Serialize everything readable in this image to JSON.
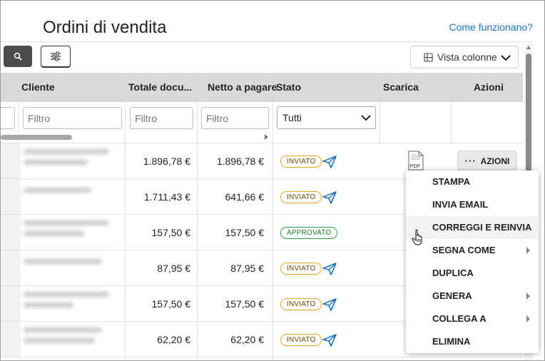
{
  "page": {
    "title": "Ordini di vendita",
    "help_link": "Come funzionano?"
  },
  "toolbar": {
    "search_icon": "search-icon",
    "filter_icon": "sliders-icon",
    "columns_button": "Vista colonne"
  },
  "table": {
    "columns": [
      "Cliente",
      "Totale docu...",
      "Netto a pagare",
      "Stato",
      "Scarica",
      "Azioni"
    ],
    "filter_placeholder": "Filtro",
    "status_filter": "Tutti",
    "rows": [
      {
        "totale": "1.896,78 €",
        "netto": "1.896,78 €",
        "stato": "INVIATO"
      },
      {
        "totale": "1.711,43 €",
        "netto": "641,66 €",
        "stato": "INVIATO"
      },
      {
        "totale": "157,50 €",
        "netto": "157,50 €",
        "stato": "APPROVATO"
      },
      {
        "totale": "87,95 €",
        "netto": "87,95 €",
        "stato": "INVIATO"
      },
      {
        "totale": "157,50 €",
        "netto": "157,50 €",
        "stato": "INVIATO"
      },
      {
        "totale": "62,20 €",
        "netto": "62,20 €",
        "stato": "INVIATO"
      }
    ],
    "pdf_label": "PDF",
    "actions_button": "AZIONI"
  },
  "actions_menu": {
    "items": [
      "STAMPA",
      "INVIA EMAIL",
      "CORREGGI E REINVIA",
      "SEGNA COME",
      "DUPLICA",
      "GENERA",
      "COLLEGA A",
      "ELIMINA"
    ]
  },
  "colors": {
    "link": "#1e73be",
    "header_bg": "#d9d9d9",
    "sent_badge": "#e5a526",
    "approved_badge": "#2f9e41",
    "send_icon": "#1e73be"
  }
}
